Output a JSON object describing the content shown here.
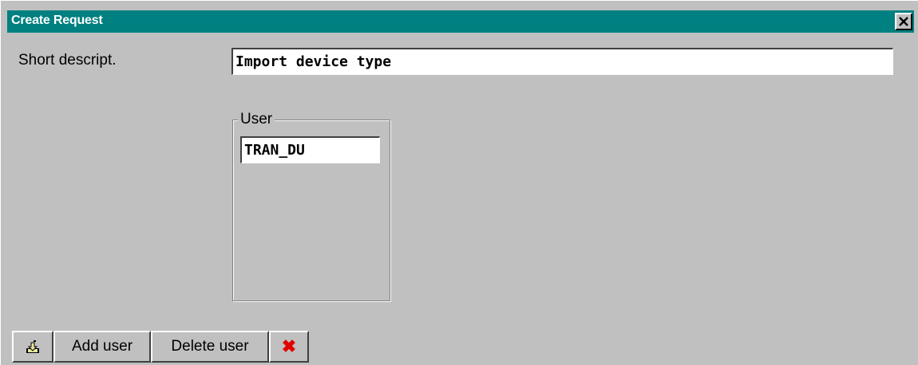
{
  "window": {
    "title": "Create Request",
    "close_symbol": "✕"
  },
  "form": {
    "short_descript_label": "Short descript.",
    "short_descript_value": "Import device type"
  },
  "user_group": {
    "legend": "User",
    "value": "TRAN_DU"
  },
  "toolbar": {
    "save_icon": "save-icon",
    "add_user_label": "Add user",
    "delete_user_label": "Delete user",
    "cancel_icon": "cancel-icon",
    "cancel_symbol": "✖"
  },
  "colors": {
    "titlebar": "#008080",
    "window_bg": "#c0c0c0",
    "cancel_red": "#e00000"
  }
}
